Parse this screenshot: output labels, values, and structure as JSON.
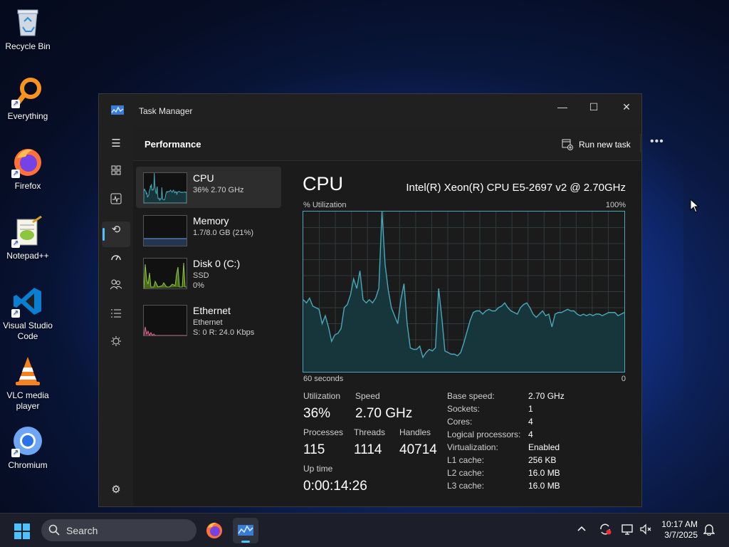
{
  "desktop": {
    "icons": [
      {
        "label": "Recycle Bin",
        "icon": "recycle-bin-icon"
      },
      {
        "label": "Everything",
        "icon": "everything-search-icon"
      },
      {
        "label": "Firefox",
        "icon": "firefox-icon"
      },
      {
        "label": "Notepad++",
        "icon": "notepad-plus-plus-icon"
      },
      {
        "label": "Visual Studio Code",
        "icon": "vscode-icon"
      },
      {
        "label": "VLC media player",
        "icon": "vlc-icon"
      },
      {
        "label": "Chromium",
        "icon": "chromium-icon"
      }
    ]
  },
  "window": {
    "title": "Task Manager",
    "controls": {
      "minimize": "—",
      "maximize": "☐",
      "close": "✕"
    }
  },
  "header": {
    "page_title": "Performance",
    "run_new_task": "Run new task",
    "more": "•••"
  },
  "devices": [
    {
      "name": "CPU",
      "sub1": "36% 2.70 GHz",
      "color": "#4aa8b8"
    },
    {
      "name": "Memory",
      "sub1": "1.7/8.0 GB (21%)",
      "color": "#6aa0e8"
    },
    {
      "name": "Disk 0 (C:)",
      "sub1": "SSD",
      "sub2": "0%",
      "color": "#8cc63f"
    },
    {
      "name": "Ethernet",
      "sub1": "Ethernet",
      "sub2": "S: 0 R: 24.0 Kbps",
      "color": "#e06b8f"
    }
  ],
  "cpu": {
    "heading": "CPU",
    "model": "Intel(R) Xeon(R) CPU E5-2697 v2 @ 2.70GHz",
    "util_label": "% Utilization",
    "util_max": "100%",
    "time_label": "60 seconds",
    "time_zero": "0",
    "stats": {
      "utilization_label": "Utilization",
      "utilization": "36%",
      "speed_label": "Speed",
      "speed": "2.70 GHz",
      "processes_label": "Processes",
      "processes": "115",
      "threads_label": "Threads",
      "threads": "1114",
      "handles_label": "Handles",
      "handles": "40714",
      "uptime_label": "Up time",
      "uptime": "0:00:14:26"
    },
    "specs": [
      {
        "k": "Base speed:",
        "v": "2.70 GHz"
      },
      {
        "k": "Sockets:",
        "v": "1"
      },
      {
        "k": "Cores:",
        "v": "4"
      },
      {
        "k": "Logical processors:",
        "v": "4"
      },
      {
        "k": "Virtualization:",
        "v": "Enabled"
      },
      {
        "k": "L1 cache:",
        "v": "256 KB"
      },
      {
        "k": "L2 cache:",
        "v": "16.0 MB"
      },
      {
        "k": "L3 cache:",
        "v": "16.0 MB"
      }
    ],
    "history": [
      45,
      43,
      46,
      41,
      40,
      39,
      30,
      35,
      28,
      19,
      23,
      24,
      27,
      40,
      42,
      48,
      58,
      52,
      63,
      45,
      43,
      45,
      43,
      46,
      52,
      100,
      67,
      51,
      40,
      35,
      30,
      45,
      55,
      30,
      15,
      14,
      14,
      16,
      9,
      12,
      14,
      13,
      15,
      52,
      34,
      13,
      12,
      11,
      11,
      10,
      12,
      18,
      25,
      32,
      37,
      38,
      38,
      36,
      38,
      39,
      38,
      38,
      40,
      41,
      43,
      40,
      38,
      37,
      36,
      40,
      42,
      43,
      40,
      36,
      34,
      36,
      38,
      35,
      36,
      28,
      36,
      37,
      37,
      38,
      39,
      38,
      38,
      36,
      35,
      36,
      35,
      36,
      35,
      36,
      36,
      35,
      36,
      37,
      37,
      37,
      35,
      36,
      37
    ]
  },
  "taskbar": {
    "search_placeholder": "Search",
    "time": "10:17 AM",
    "date": "3/7/2025"
  }
}
